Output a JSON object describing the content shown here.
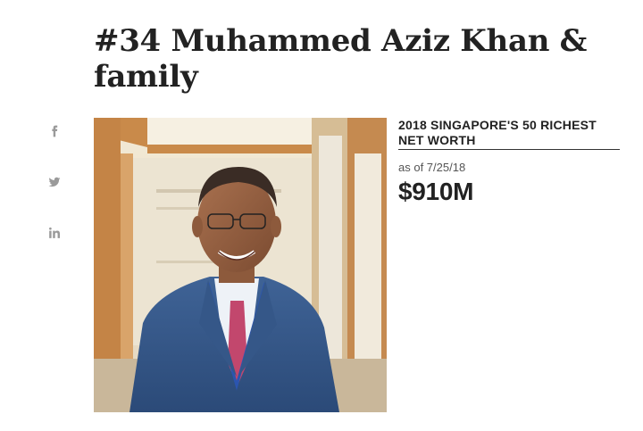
{
  "profile": {
    "title": "#34 Muhammed Aziz Khan & family",
    "photo_alt": "Muhammed Aziz Khan",
    "list_title": "2018 SINGAPORE'S 50 RICHEST NET WORTH",
    "as_of": "as of 7/25/18",
    "net_worth": "$910M"
  },
  "social": {
    "items": [
      {
        "icon": "facebook-icon"
      },
      {
        "icon": "twitter-icon"
      },
      {
        "icon": "linkedin-icon"
      }
    ]
  }
}
